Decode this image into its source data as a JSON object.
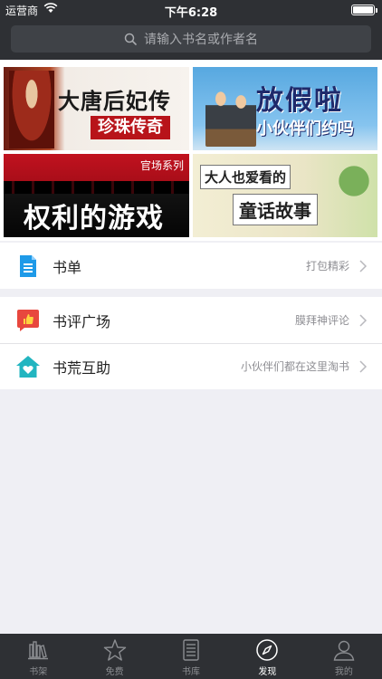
{
  "status": {
    "carrier": "运营商",
    "time": "下午6:28"
  },
  "search": {
    "placeholder": "请输入书名或作者名",
    "icon": "search-icon"
  },
  "banners": [
    {
      "line1": "大唐后妃传",
      "line2": "珍珠传奇"
    },
    {
      "line1": "放假啦",
      "line2": "小伙伴们约吗"
    },
    {
      "tag": "官场系列",
      "line1": "权利的游戏"
    },
    {
      "line1": "大人也爱看的",
      "line2": "童话故事"
    }
  ],
  "list1": [
    {
      "title": "书单",
      "subtitle": "打包精彩",
      "icon": "booklist-icon",
      "color": "#1e9ae8"
    }
  ],
  "list2": [
    {
      "title": "书评广场",
      "subtitle": "膜拜神评论",
      "icon": "thumbs-up-icon",
      "color": "#e8473e"
    },
    {
      "title": "书荒互助",
      "subtitle": "小伙伴们都在这里淘书",
      "icon": "house-heart-icon",
      "color": "#22b5c0"
    }
  ],
  "tabs": [
    {
      "label": "书架",
      "icon": "bookshelf-icon",
      "active": false
    },
    {
      "label": "免费",
      "icon": "star-icon",
      "active": false
    },
    {
      "label": "书库",
      "icon": "library-icon",
      "active": false
    },
    {
      "label": "发现",
      "icon": "compass-icon",
      "active": true
    },
    {
      "label": "我的",
      "icon": "person-icon",
      "active": false
    }
  ],
  "colors": {
    "bar": "#2e3034",
    "background": "#efeff4",
    "tab_active": "#ffffff",
    "tab_inactive": "#8b8d91"
  }
}
